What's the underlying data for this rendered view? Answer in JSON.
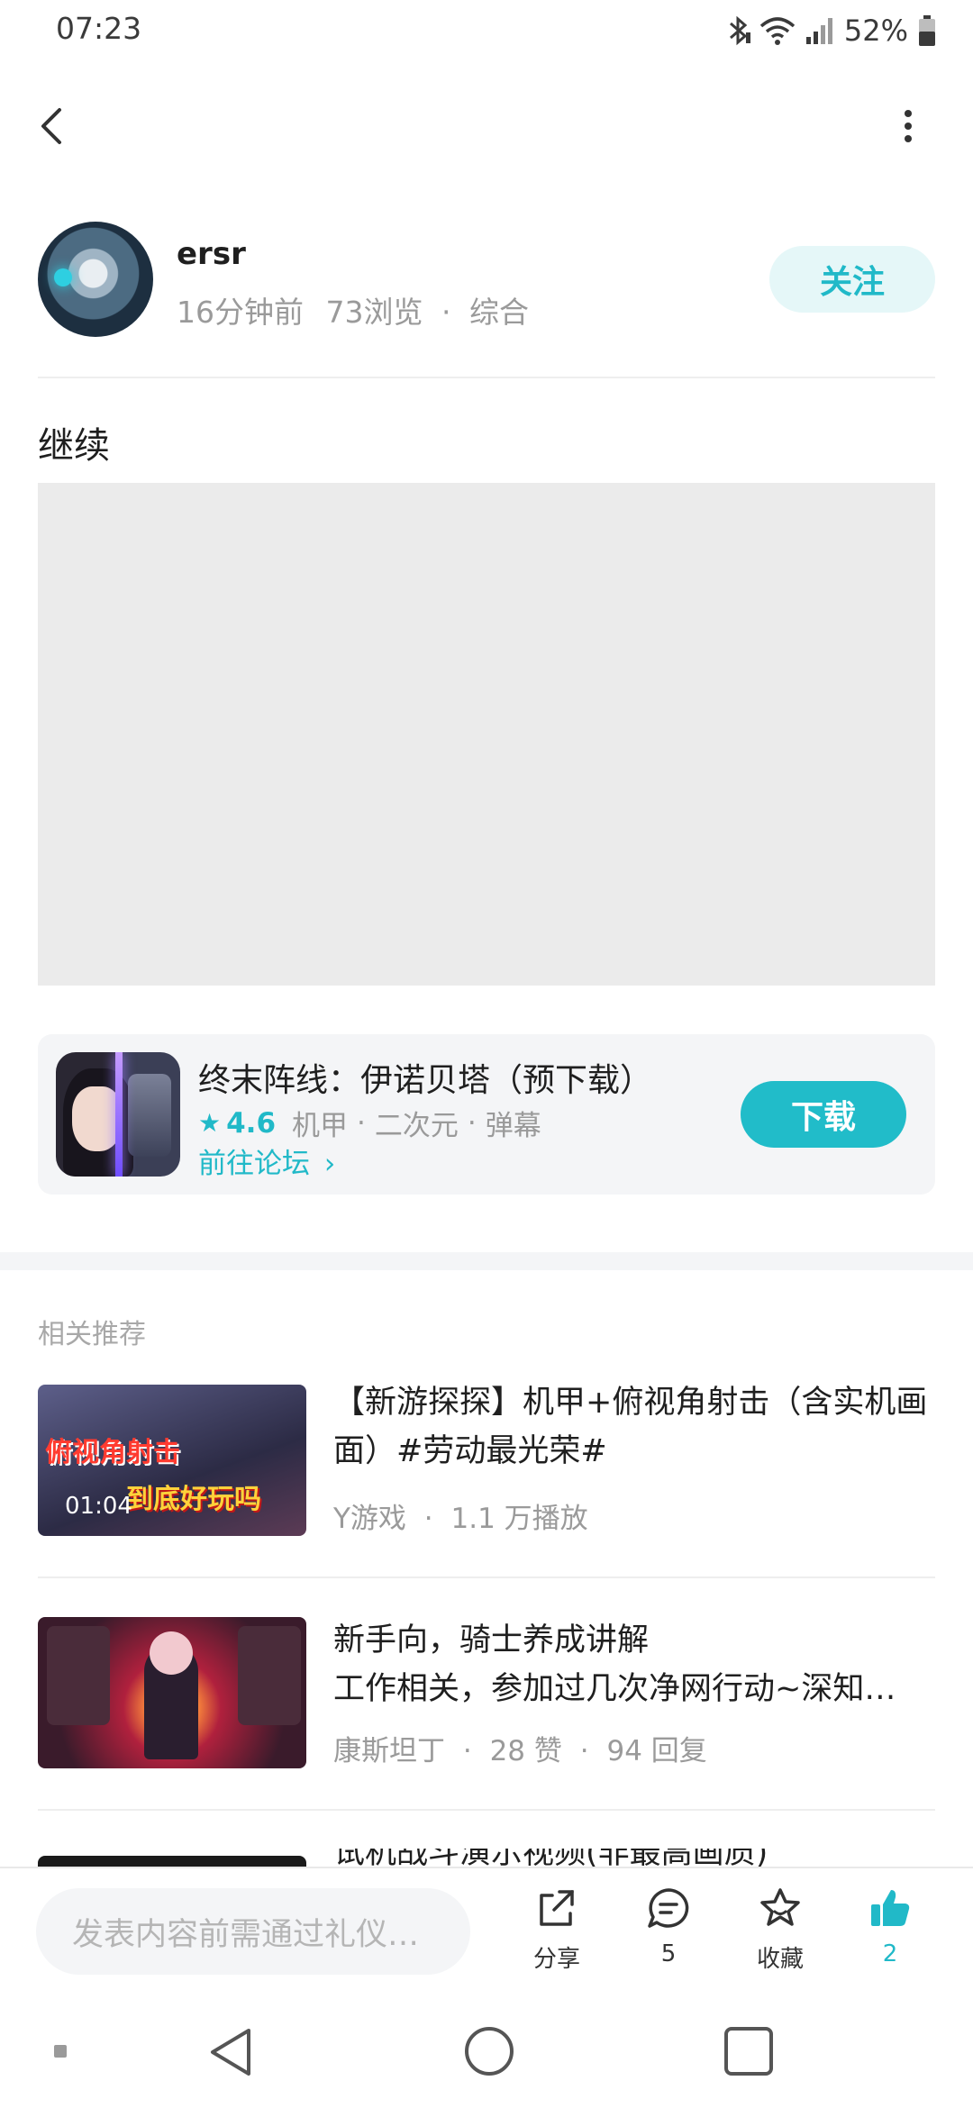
{
  "status_bar": {
    "time": "07:23",
    "battery": "52%"
  },
  "author": {
    "name": "ersr",
    "time_ago": "16分钟前",
    "views": "73浏览",
    "separator": "·",
    "category": "综合",
    "follow_label": "关注"
  },
  "post": {
    "title": "继续"
  },
  "game": {
    "name": "终末阵线：伊诺贝塔（预下载）",
    "rating": "4.6",
    "tags": [
      "机甲",
      "二次元",
      "弹幕"
    ],
    "forum_link": "前往论坛",
    "download_label": "下载"
  },
  "related": {
    "section_title": "相关推荐",
    "items": [
      {
        "title": "【新游探探】机甲+俯视角射击（含实机画面）#劳动最光荣#",
        "author": "Y游戏",
        "stat": "1.1 万播放",
        "duration": "01:04",
        "thumb_text_1": "俯视角射击",
        "thumb_text_2": "到底好玩吗"
      },
      {
        "title": "新手向，骑士养成讲解",
        "subtitle": "工作相关，参加过几次净网行动~深知…",
        "author": "康斯坦丁",
        "likes": "28 赞",
        "replies": "94 回复"
      },
      {
        "title": "试机战斗演示视频(非最高画质)"
      }
    ]
  },
  "action_bar": {
    "comment_placeholder": "发表内容前需通过礼仪…",
    "share_label": "分享",
    "comment_count": "5",
    "favorite_label": "收藏",
    "like_count": "2"
  },
  "colors": {
    "accent": "#21b9c8",
    "follow_bg": "#e5f7f8",
    "card_bg": "#f4f5f7",
    "placeholder_bg": "#ebebeb"
  },
  "icons": [
    "back-icon",
    "more-icon",
    "bluetooth-icon",
    "wifi-icon",
    "signal-icon",
    "battery-icon",
    "star-icon",
    "chevron-right-icon",
    "share-icon",
    "comment-icon",
    "favorite-icon",
    "like-icon",
    "nav-back-icon",
    "nav-home-icon",
    "nav-recents-icon"
  ]
}
